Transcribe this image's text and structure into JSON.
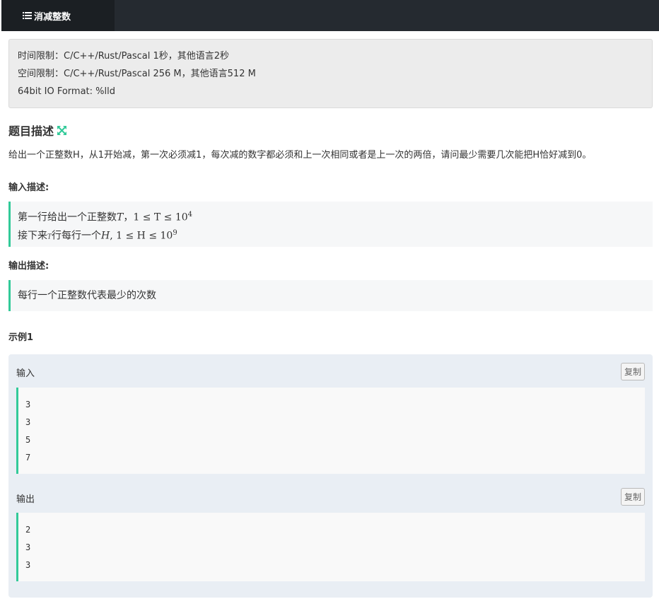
{
  "header": {
    "tab_label": "消减整数"
  },
  "limits": {
    "time": "时间限制：C/C++/Rust/Pascal 1秒，其他语言2秒",
    "space": "空间限制：C/C++/Rust/Pascal 256 M，其他语言512 M",
    "io_format": "64bit IO Format: %lld"
  },
  "description": {
    "title": "题目描述",
    "text": "给出一个正整数H，从1开始减，第一次必须减1，每次减的数字都必须和上一次相同或者是上一次的两倍，请问最少需要几次能把H恰好减到0。"
  },
  "input_desc": {
    "title": "输入描述:",
    "line1_text": "第一行给出一个正整数",
    "line1_var": "T",
    "line1_sep": "，",
    "line1_formula": "1 ≤ T ≤ 10",
    "line1_exp": "4",
    "line2_text": "接下来",
    "line2_small": "T",
    "line2_text2": "行每行一个",
    "line2_var": "H",
    "line2_formula": ", 1 ≤ H ≤ 10",
    "line2_exp": "9"
  },
  "output_desc": {
    "title": "输出描述:",
    "text": "每行一个正整数代表最少的次数"
  },
  "example": {
    "title": "示例1",
    "input_label": "输入",
    "input_lines": [
      "3",
      "3",
      "5",
      "7"
    ],
    "output_label": "输出",
    "output_lines": [
      "2",
      "3",
      "3"
    ],
    "copy_label": "复制"
  },
  "colors": {
    "accent": "#32ca99",
    "topbar": "#252a30"
  }
}
